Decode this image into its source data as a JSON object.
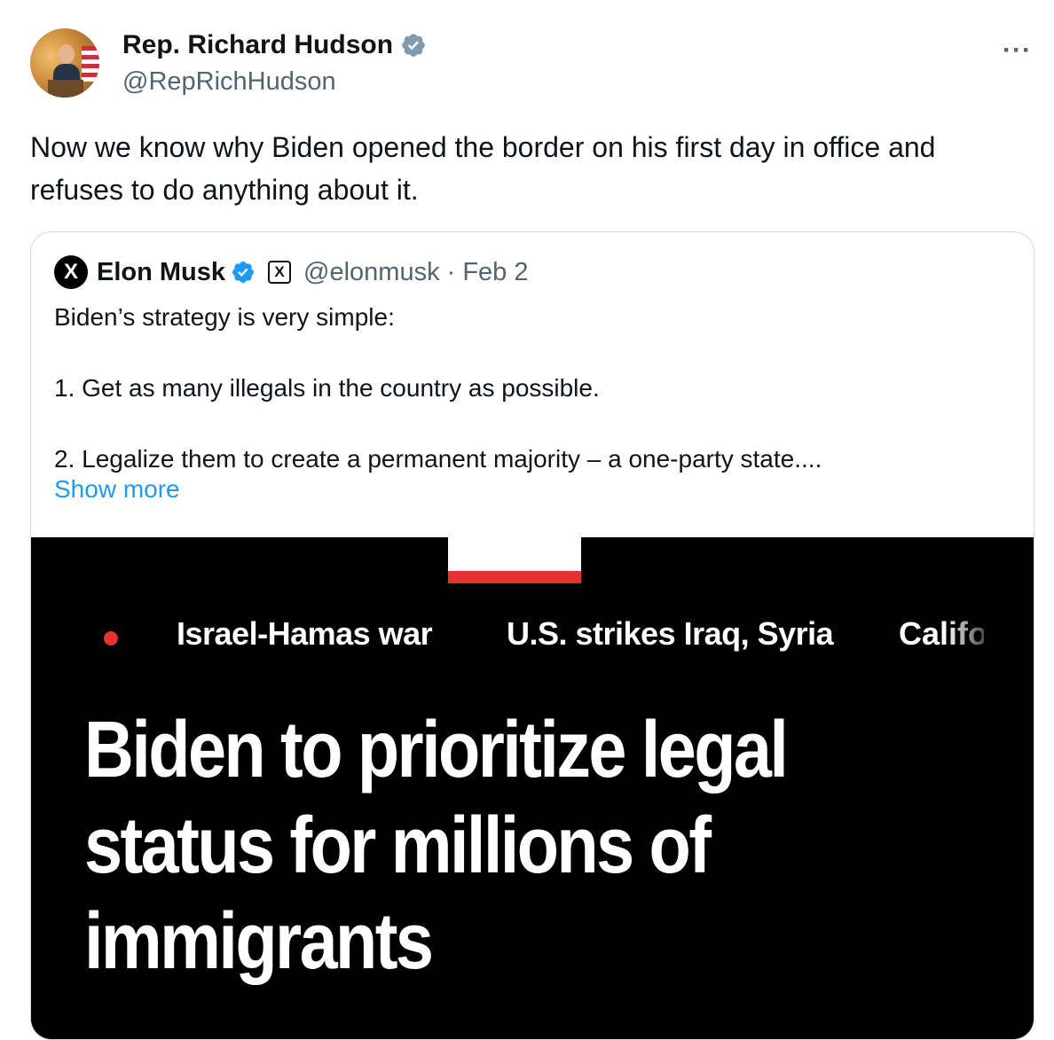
{
  "author": {
    "display_name": "Rep. Richard Hudson",
    "handle": "@RepRichHudson",
    "verified": true
  },
  "more_menu": "···",
  "tweet": {
    "text_line1": "Now we know why Biden opened the border on his first day in office and",
    "text_line2": "refuses to do anything about it."
  },
  "quoted": {
    "avatar_glyph": "X",
    "display_name": "Elon Musk",
    "badge_glyph": "X",
    "handle_date": "@elonmusk · Feb 2",
    "lines": [
      "Biden’s strategy is very simple:",
      "1. Get as many illegals in the country as possible.",
      "2. Legalize them to create a permanent majority – a one-party state...."
    ],
    "show_more": "Show more",
    "media": {
      "topics": [
        "Israel-Hamas war",
        "U.S. strikes Iraq, Syria",
        "Califo"
      ],
      "headline_lines": [
        "Biden to prioritize legal",
        "status for millions of",
        "immigrants"
      ]
    }
  },
  "colors": {
    "verified_blue": "#1d9bf0",
    "link_blue": "#1d9bf0",
    "accent_red": "#e83131"
  }
}
